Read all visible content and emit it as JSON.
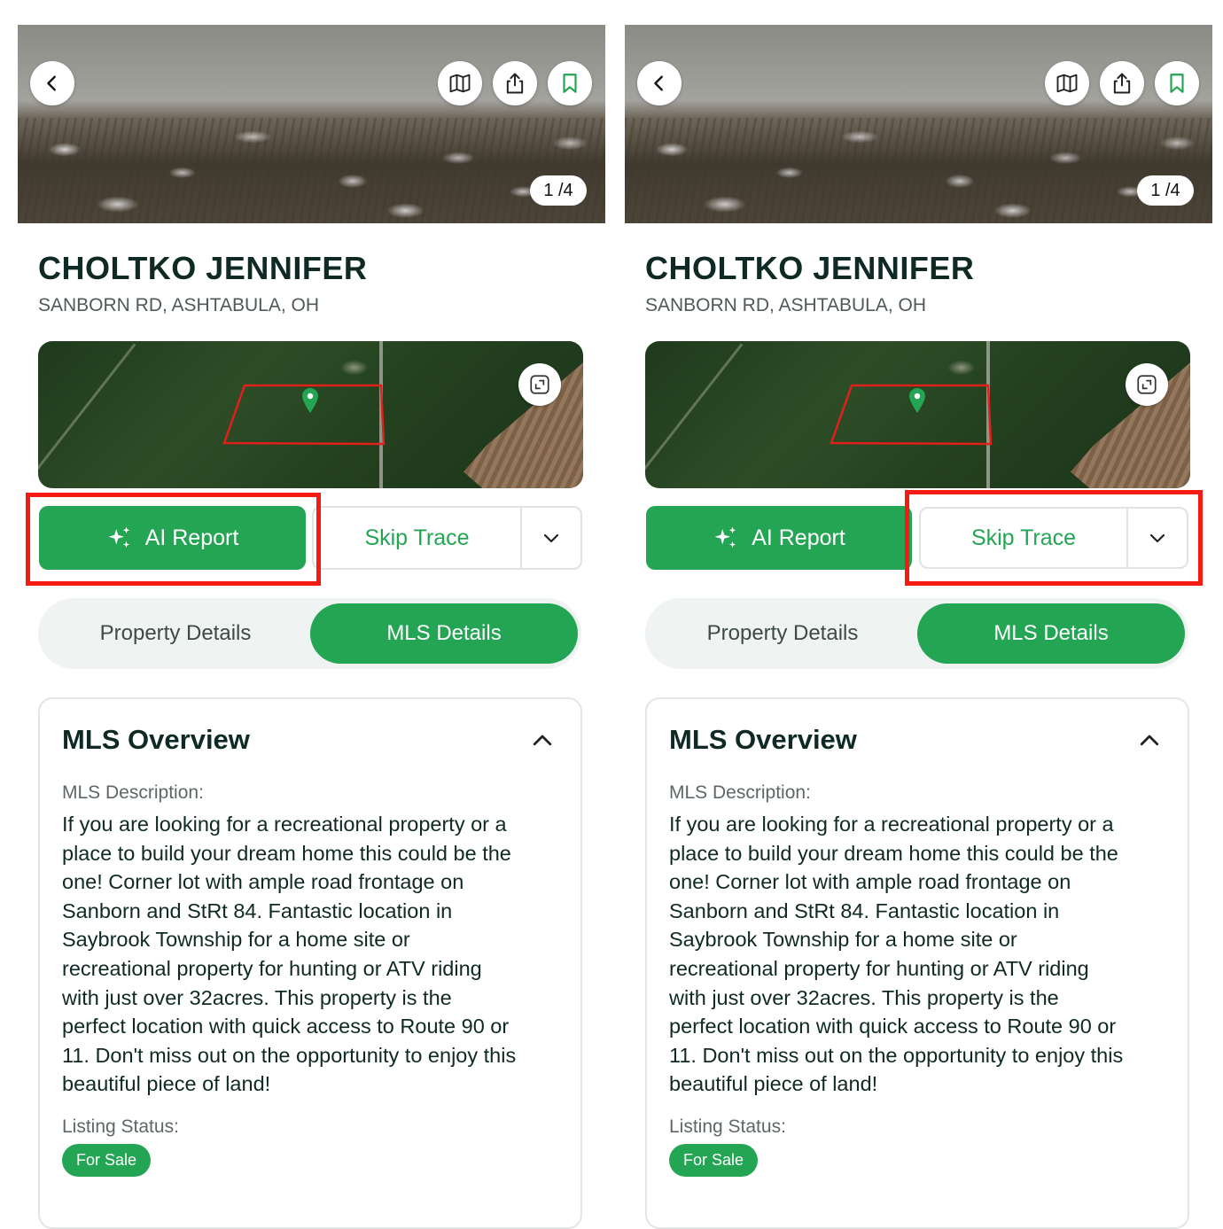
{
  "panels": [
    {
      "id": "left",
      "highlighted": "ai-report",
      "photo": {
        "counter": "1 /4"
      },
      "owner_name": "CHOLTKO JENNIFER",
      "address": "SANBORN RD, ASHTABULA, OH",
      "actions": {
        "ai_report_label": "AI Report",
        "skip_trace_label": "Skip Trace"
      },
      "tabs": [
        {
          "label": "Property Details",
          "active": false
        },
        {
          "label": "MLS Details",
          "active": true
        }
      ],
      "overview": {
        "title": "MLS Overview",
        "description_label": "MLS Description:",
        "description_lines": [
          "If you are looking for a recreational property or a",
          "place to build your dream home this could be the",
          "one! Corner lot with ample road frontage on",
          "Sanborn and StRt 84. Fantastic location in",
          "Saybrook Township for a home site or",
          "recreational property for hunting or ATV riding",
          "with just over 32acres. This property is the",
          "perfect location with quick access to Route 90 or",
          "11. Don't miss out on the opportunity to enjoy this",
          "beautiful piece of land!"
        ],
        "status_label": "Listing Status:",
        "status_value": "For Sale"
      }
    },
    {
      "id": "right",
      "highlighted": "skip-trace",
      "photo": {
        "counter": "1 /4"
      },
      "owner_name": "CHOLTKO JENNIFER",
      "address": "SANBORN RD, ASHTABULA, OH",
      "actions": {
        "ai_report_label": "AI Report",
        "skip_trace_label": "Skip Trace"
      },
      "tabs": [
        {
          "label": "Property Details",
          "active": false
        },
        {
          "label": "MLS Details",
          "active": true
        }
      ],
      "overview": {
        "title": "MLS Overview",
        "description_label": "MLS Description:",
        "description_lines": [
          "If you are looking for a recreational property or a",
          "place to build your dream home this could be the",
          "one! Corner lot with ample road frontage on",
          "Sanborn and StRt 84. Fantastic location in",
          "Saybrook Township for a home site or",
          "recreational property for hunting or ATV riding",
          "with just over 32acres. This property is the",
          "perfect location with quick access to Route 90 or",
          "11. Don't miss out on the opportunity to enjoy this",
          "beautiful piece of land!"
        ],
        "status_label": "Listing Status:",
        "status_value": "For Sale"
      }
    }
  ],
  "icons": [
    "back-icon",
    "map-icon",
    "share-icon",
    "bookmark-icon",
    "expand-icon",
    "sparkles-icon",
    "chevron-down-icon",
    "chevron-up-icon",
    "location-pin-icon"
  ],
  "colors": {
    "brand_green": "#24a554",
    "highlight_red": "#f51a12",
    "title_dark": "#0f2a24",
    "parcel_outline": "#e0201a"
  }
}
